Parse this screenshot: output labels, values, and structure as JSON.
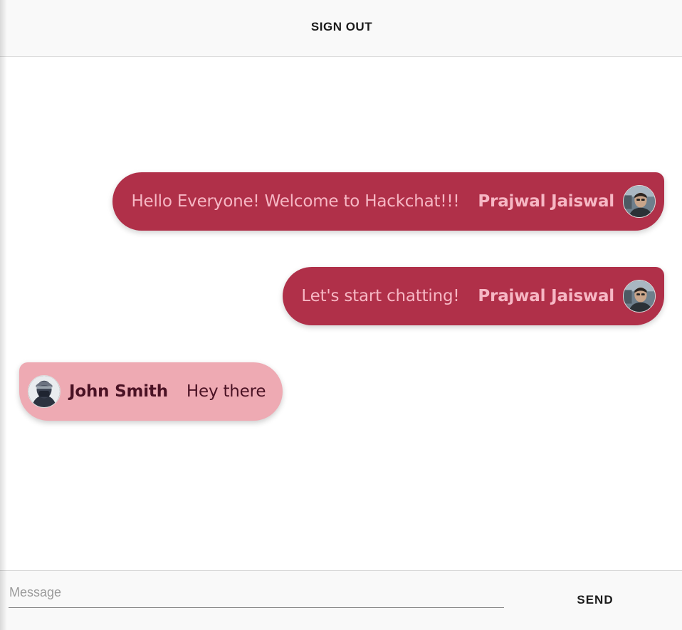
{
  "header": {
    "sign_out_label": "SIGN OUT"
  },
  "messages": [
    {
      "direction": "sent",
      "text": "Hello Everyone! Welcome to Hackchat!!!",
      "author": "Prajwal Jaiswal"
    },
    {
      "direction": "sent",
      "text": "Let's start chatting!",
      "author": "Prajwal Jaiswal"
    },
    {
      "direction": "received",
      "text": "Hey there",
      "author": "John Smith"
    }
  ],
  "composer": {
    "placeholder": "Message",
    "value": "",
    "send_label": "SEND"
  },
  "colors": {
    "sent_bubble": "#b03049",
    "sent_text": "#f6b7c4",
    "received_bubble": "#eeaab3",
    "received_text": "#4a1224"
  }
}
